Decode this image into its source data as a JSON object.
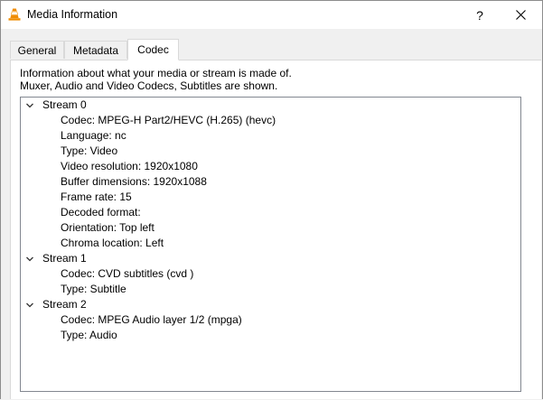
{
  "window": {
    "title": "Media Information",
    "help_label": "?",
    "close_label": "✕"
  },
  "tabs": [
    {
      "label": "General"
    },
    {
      "label": "Metadata"
    },
    {
      "label": "Codec"
    }
  ],
  "active_tab": "Codec",
  "description": {
    "line1": "Information about what your media or stream is made of.",
    "line2": "Muxer, Audio and Video Codecs, Subtitles are shown."
  },
  "streams": [
    {
      "label": "Stream 0",
      "expanded": true,
      "items": [
        "Codec: MPEG-H Part2/HEVC (H.265) (hevc)",
        "Language: nc",
        "Type: Video",
        "Video resolution: 1920x1080",
        "Buffer dimensions: 1920x1088",
        "Frame rate: 15",
        "Decoded format:",
        "Orientation: Top left",
        "Chroma location: Left"
      ]
    },
    {
      "label": "Stream 1",
      "expanded": true,
      "items": [
        "Codec: CVD subtitles (cvd )",
        "Type: Subtitle"
      ]
    },
    {
      "label": "Stream 2",
      "expanded": true,
      "items": [
        "Codec: MPEG Audio layer 1/2 (mpga)",
        "Type: Audio"
      ]
    }
  ],
  "colors": {
    "window_bg": "#f0f0f0",
    "panel_bg": "#ffffff",
    "vlc_orange": "#f08c00"
  },
  "icons": {
    "app": "vlc-cone-icon",
    "expand": "chevron-down-icon"
  }
}
